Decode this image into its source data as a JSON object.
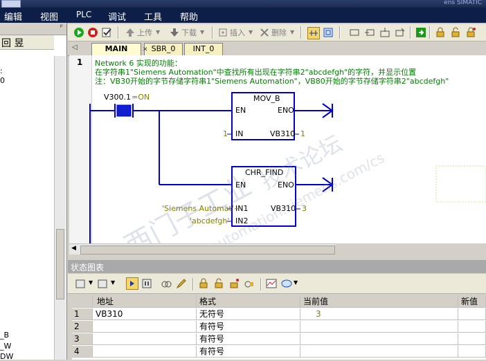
{
  "window": {
    "title_right": "ens SIMATIC"
  },
  "menubar": {
    "items": [
      "编辑",
      "视图",
      "PLC",
      "调试",
      "工具",
      "帮助"
    ]
  },
  "left_panel": {
    "pin": "ᵖ",
    "toolbar_glyph": "回 昱",
    "fragments": [
      ":",
      "0",
      "_B",
      "_W",
      "DW"
    ]
  },
  "toolbar": {
    "upload": "上传",
    "download": "下载",
    "insert": "插入",
    "delete": "删除"
  },
  "tabs": [
    {
      "label": "MAIN",
      "active": true
    },
    {
      "label": "SBR_0",
      "active": false
    },
    {
      "label": "INT_0",
      "active": false
    }
  ],
  "editor": {
    "network_number": "1",
    "comment_lines": [
      "Network 6 实现的功能：",
      "在字符串1\"Siemens Automation\"中查找所有出现在字符串2\"abcdefgh\"的字符，并显示位置",
      "注：VB30开始的字节存储字符串1\"Siemens Automation\"，VB80开始的字节存储字符串2\"abcdefgh\""
    ],
    "contact": {
      "label": "V300.1",
      "status": "=ON"
    },
    "mov_b": {
      "title": "MOV_B",
      "en": "EN",
      "eno": "ENO",
      "in": "IN",
      "in_value": "1",
      "out": "VB310",
      "out_value": "1"
    },
    "chr_find": {
      "title": "CHR_FIND",
      "en": "EN",
      "eno": "ENO",
      "in1": "IN1",
      "in1_value": "'Siemens Automat'~",
      "in2": "IN2",
      "in2_value": "'abcdefgh'",
      "out": "VB310",
      "out_value": "3"
    }
  },
  "status_chart": {
    "title": "状态图表",
    "columns": [
      "地址",
      "格式",
      "当前值",
      "新值"
    ],
    "rows": [
      {
        "num": "1",
        "address": "VB310",
        "format": "无符号",
        "current": "3",
        "new": ""
      },
      {
        "num": "2",
        "address": "",
        "format": "有符号",
        "current": "",
        "new": ""
      },
      {
        "num": "3",
        "address": "",
        "format": "有符号",
        "current": "",
        "new": ""
      },
      {
        "num": "4",
        "address": "",
        "format": "有符号",
        "current": "",
        "new": ""
      }
    ]
  },
  "watermark": {
    "lines": [
      "西门子工业",
      "技术论坛",
      "support.automation.siemens.com/cs"
    ]
  },
  "colors": {
    "menubar": "#0d1f48",
    "ladder_blue": "#0000cc",
    "comment_green": "#008000",
    "value_olive": "#808000"
  }
}
